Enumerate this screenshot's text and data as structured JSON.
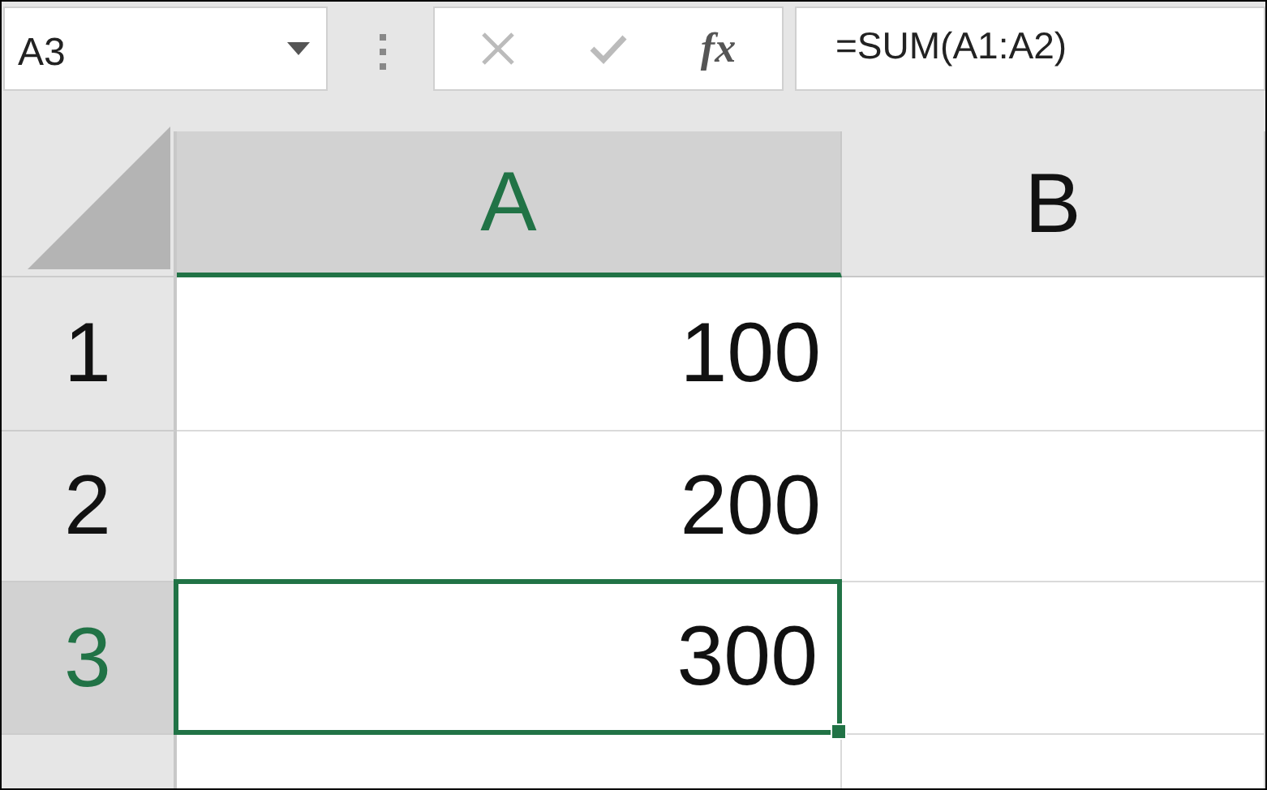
{
  "name_box": {
    "value": "A3"
  },
  "formula_bar": {
    "function_button": "fx",
    "value": "=SUM(A1:A2)"
  },
  "columns": [
    {
      "label": "A",
      "selected": true
    },
    {
      "label": "B",
      "selected": false
    }
  ],
  "rows": [
    {
      "header": "1",
      "selected": false,
      "cells": [
        {
          "value": "100",
          "active": false
        },
        {
          "active": false
        }
      ]
    },
    {
      "header": "2",
      "selected": false,
      "cells": [
        {
          "value": "200",
          "active": false
        },
        {
          "active": false
        }
      ]
    },
    {
      "header": "3",
      "selected": true,
      "cells": [
        {
          "value": "300",
          "active": true
        },
        {
          "active": false
        }
      ]
    },
    {
      "selected": false,
      "cells": [
        {
          "active": false
        },
        {
          "active": false
        }
      ]
    }
  ]
}
